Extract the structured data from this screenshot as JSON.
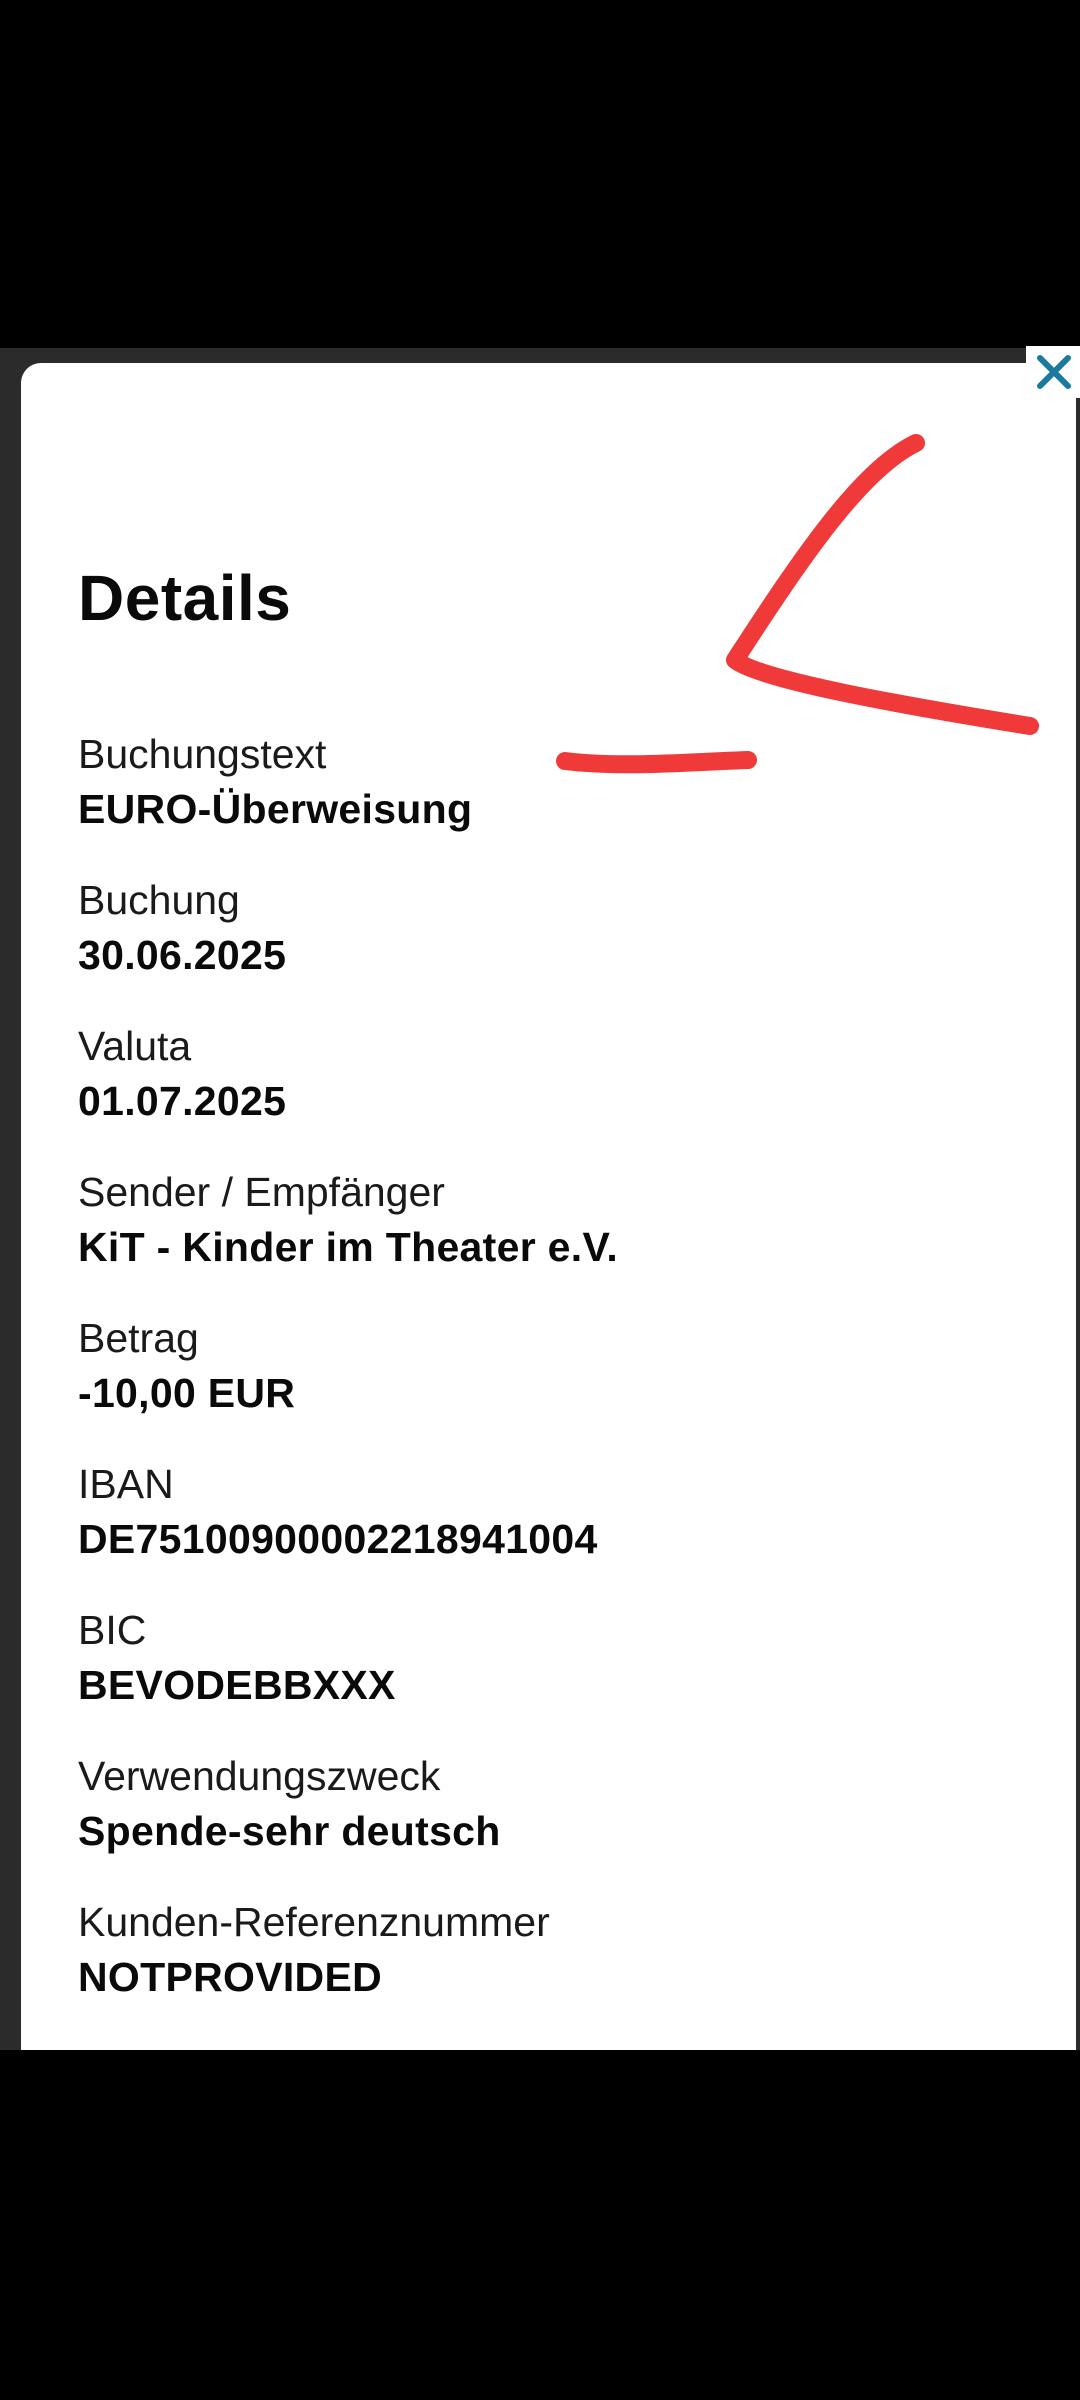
{
  "title": "Details",
  "close_icon": "close-icon",
  "accent_color": "#1b7a9e",
  "fields": [
    {
      "label": "Buchungstext",
      "value": "EURO-Überweisung"
    },
    {
      "label": "Buchung",
      "value": "30.06.2025"
    },
    {
      "label": "Valuta",
      "value": "01.07.2025"
    },
    {
      "label": "Sender / Empfänger",
      "value": "KiT - Kinder im Theater e.V."
    },
    {
      "label": "Betrag",
      "value": "-10,00 EUR"
    },
    {
      "label": "IBAN",
      "value": "DE75100900002218941004"
    },
    {
      "label": "BIC",
      "value": "BEVODEBBXXX"
    },
    {
      "label": "Verwendungszweck",
      "value": "Spende-sehr deutsch"
    },
    {
      "label": "Kunden-Referenznummer",
      "value": "NOTPROVIDED"
    }
  ]
}
